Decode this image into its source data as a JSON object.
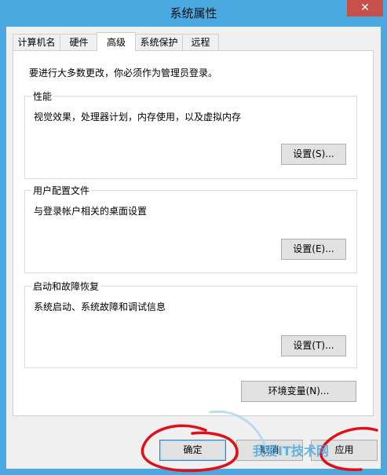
{
  "window": {
    "title": "系统属性",
    "close_glyph": "✕"
  },
  "tabs": [
    {
      "label": "计算机名",
      "active": false
    },
    {
      "label": "硬件",
      "active": false
    },
    {
      "label": "高级",
      "active": true
    },
    {
      "label": "系统保护",
      "active": false
    },
    {
      "label": "远程",
      "active": false
    }
  ],
  "advanced": {
    "admin_note": "要进行大多数更改，你必须作为管理员登录。",
    "performance": {
      "title": "性能",
      "description": "视觉效果，处理器计划，内存使用，以及虚拟内存",
      "settings_label": "设置(S)..."
    },
    "user_profiles": {
      "title": "用户配置文件",
      "description": "与登录帐户相关的桌面设置",
      "settings_label": "设置(E)..."
    },
    "startup_recovery": {
      "title": "启动和故障恢复",
      "description": "系统启动、系统故障和调试信息",
      "settings_label": "设置(T)..."
    },
    "env_vars_label": "环境变量(N)..."
  },
  "footer": {
    "ok_label": "确定",
    "cancel_label": "取消",
    "apply_label": "应用"
  },
  "watermark": {
    "text": "我爱IT技术网"
  },
  "colors": {
    "titlebar": "#4aa9e0",
    "close": "#c7504a",
    "annotation": "#e0101a"
  }
}
